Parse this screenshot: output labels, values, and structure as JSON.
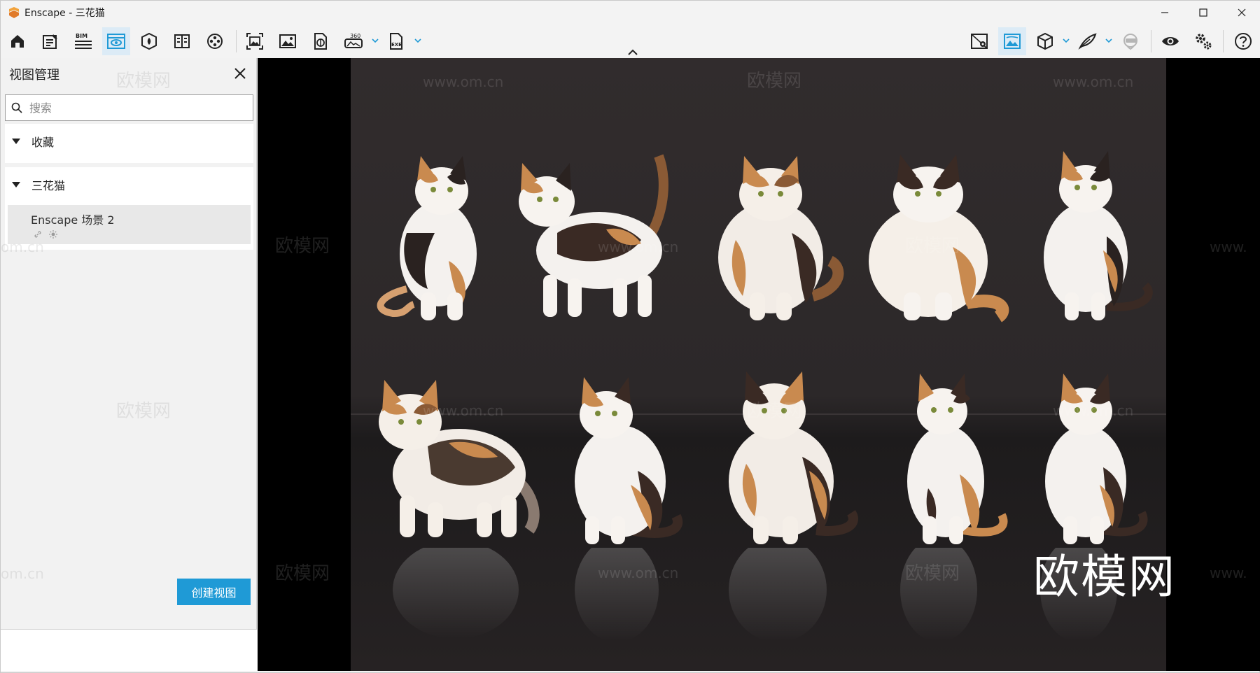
{
  "window": {
    "title": "Enscape - 三花猫",
    "accent": "#1f9ad6",
    "logo_color": "#f2a23a"
  },
  "toolbar": {
    "left_tools": [
      {
        "name": "home-icon"
      },
      {
        "name": "notes-icon"
      },
      {
        "name": "bim-icon",
        "label": "BIM"
      },
      {
        "name": "view-management-icon",
        "active": true
      },
      {
        "name": "asset-library-icon"
      },
      {
        "name": "material-editor-icon"
      },
      {
        "name": "video-editor-icon"
      },
      {
        "name": "batch-render-icon"
      },
      {
        "name": "screenshot-icon"
      },
      {
        "name": "export-panorama-icon"
      },
      {
        "name": "panorama-360-icon",
        "label": "360"
      },
      {
        "name": "export-exe-icon",
        "label": "EXE"
      }
    ],
    "right_tools": [
      {
        "name": "site-context-icon"
      },
      {
        "name": "atmosphere-icon",
        "active": true
      },
      {
        "name": "cube-icon"
      },
      {
        "name": "feather-icon"
      },
      {
        "name": "vr-headset-icon"
      },
      {
        "name": "eye-icon"
      },
      {
        "name": "settings-icon"
      },
      {
        "name": "help-icon"
      }
    ]
  },
  "panel": {
    "title": "视图管理",
    "search_placeholder": "搜索",
    "groups": [
      {
        "label": "收藏"
      },
      {
        "label": "三花猫"
      }
    ],
    "views": [
      {
        "name": "Enscape 场景 2"
      }
    ],
    "create_button": "创建视图"
  },
  "viewport": {
    "watermark_brand": "欧模网",
    "watermark_url": "www.om.cn",
    "watermark_fragment": "om.cn",
    "watermark_fragment_right": "www.",
    "big_watermark": "欧模网"
  }
}
